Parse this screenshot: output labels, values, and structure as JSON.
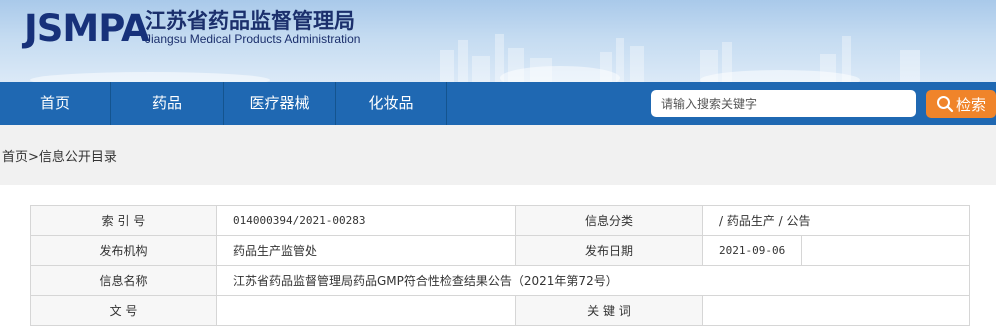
{
  "header": {
    "logo_abbr": "JSMPA",
    "logo_cn": "江苏省药品监督管理局",
    "logo_en": "Jiangsu Medical Products Administration"
  },
  "nav": {
    "items": [
      {
        "label": "首页"
      },
      {
        "label": "药品"
      },
      {
        "label": "医疗器械"
      },
      {
        "label": "化妆品"
      }
    ],
    "search_placeholder": "请输入搜索关键字",
    "search_button": "检索"
  },
  "breadcrumb": {
    "home": "首页",
    "separator": ">",
    "current": "信息公开目录"
  },
  "info": {
    "index_label": "索 引 号",
    "index_value": "014000394/2021-00283",
    "category_label": "信息分类",
    "category_value": "/ 药品生产 / 公告",
    "publisher_label": "发布机构",
    "publisher_value": "药品生产监管处",
    "date_label": "发布日期",
    "date_value": "2021-09-06",
    "name_label": "信息名称",
    "name_value": "江苏省药品监督管理局药品GMP符合性检查结果公告（2021年第72号）",
    "docno_label": "文 号",
    "docno_value": "",
    "keywords_label": "关 键 词",
    "keywords_value": ""
  }
}
